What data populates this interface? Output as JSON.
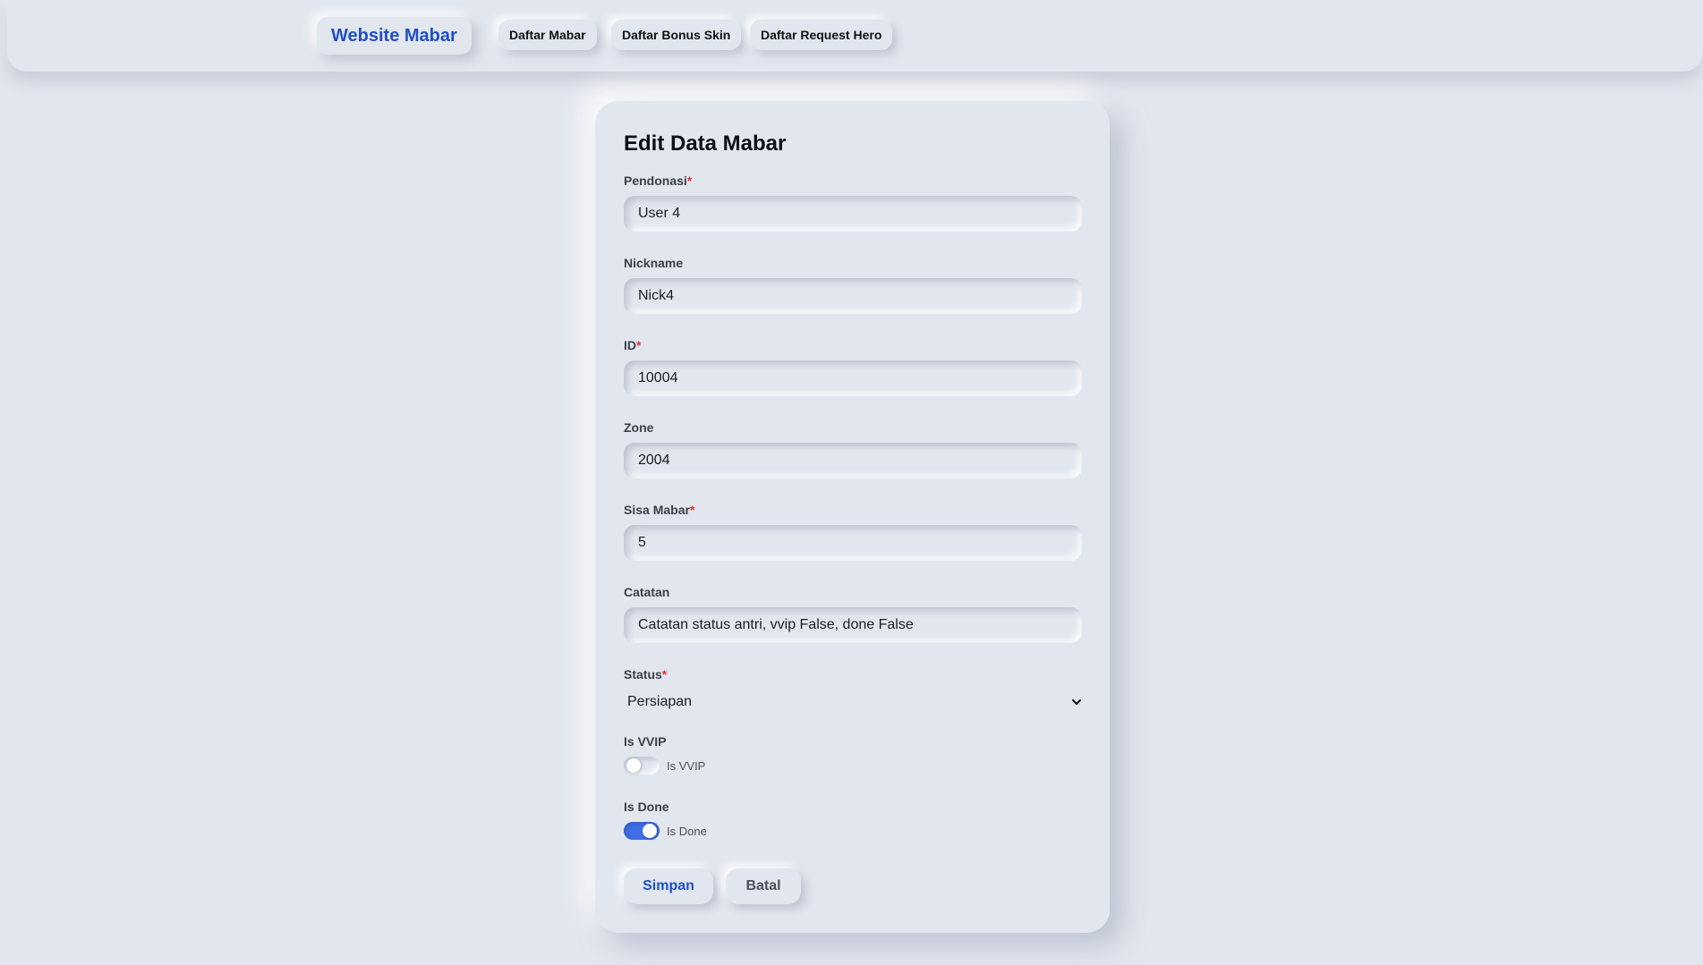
{
  "navbar": {
    "brand": "Website Mabar",
    "links": [
      "Daftar Mabar",
      "Daftar Bonus Skin",
      "Daftar Request Hero"
    ]
  },
  "form": {
    "title": "Edit Data Mabar",
    "required_marker": "*",
    "fields": {
      "pendonasi": {
        "label": "Pendonasi",
        "value": "User 4",
        "required": true
      },
      "nickname": {
        "label": "Nickname",
        "value": "Nick4",
        "required": false
      },
      "id": {
        "label": "ID",
        "value": "10004",
        "required": true
      },
      "zone": {
        "label": "Zone",
        "value": "2004",
        "required": false
      },
      "sisa_mabar": {
        "label": "Sisa Mabar",
        "value": "5",
        "required": true
      },
      "catatan": {
        "label": "Catatan",
        "value": "Catatan status antri, vvip False, done False",
        "required": false
      }
    },
    "status": {
      "label": "Status",
      "value": "Persiapan",
      "required": true
    },
    "is_vvip": {
      "label": "Is VVIP",
      "toggle_label": "Is VVIP",
      "checked": false
    },
    "is_done": {
      "label": "Is Done",
      "toggle_label": "Is Done",
      "checked": true
    },
    "buttons": {
      "save": "Simpan",
      "cancel": "Batal"
    }
  },
  "colors": {
    "background": "#e2e6ee",
    "accent": "#1f4fc4",
    "toggle_on": "#3f6fe6",
    "required": "#e0342f"
  }
}
